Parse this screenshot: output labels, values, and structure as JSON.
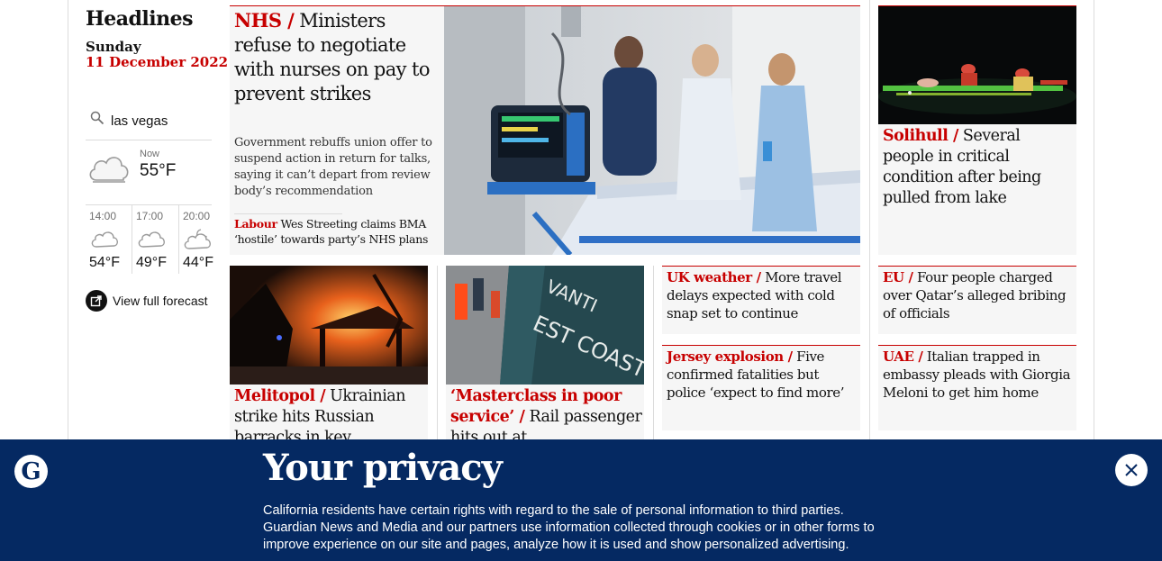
{
  "sidebar": {
    "title": "Headlines",
    "day": "Sunday",
    "date": "11 December 2022",
    "search_location": "las vegas",
    "weather_now": {
      "label": "Now",
      "temp": "55°F",
      "icon": "cloud-icon"
    },
    "forecast": [
      {
        "time": "14:00",
        "temp": "54°F",
        "icon": "cloud-icon"
      },
      {
        "time": "17:00",
        "temp": "49°F",
        "icon": "cloud-icon"
      },
      {
        "time": "20:00",
        "temp": "44°F",
        "icon": "partly-cloudy-night-icon"
      }
    ],
    "forecast_link": "View full forecast"
  },
  "main_story": {
    "kicker": "NHS /",
    "headline": " Ministers refuse to negotiate with nurses on pay to prevent strikes",
    "standfirst": "Government rebuffs union offer to suspend action in return for talks, saying it can’t depart from review body’s recommendation",
    "sublink_kicker": "Labour",
    "sublink_text": " Wes Streeting claims BMA ‘hostile’ towards party’s NHS plans"
  },
  "stories": {
    "solihull": {
      "kicker": "Solihull /",
      "headline": " Several people in critical condition after being pulled from lake"
    },
    "melitopol": {
      "kicker": "Melitopol /",
      "headline": " Ukrainian strike hits Russian barracks in key"
    },
    "avanti": {
      "kicker": "‘Masterclass in poor service’ /",
      "headline": " Rail passenger hits out at"
    },
    "uk_weather": {
      "kicker": "UK weather /",
      "headline": " More travel delays expected with cold snap set to continue"
    },
    "jersey": {
      "kicker": "Jersey explosion /",
      "headline": " Five confirmed fatalities but police ‘expect to find more’"
    },
    "eu": {
      "kicker": "EU /",
      "headline": " Four people charged over Qatar’s alleged bribing of officials"
    },
    "uae": {
      "kicker": "UAE /",
      "headline": " Italian trapped in embassy pleads with Giorgia Meloni to get him home"
    }
  },
  "avanti_train_text": {
    "line1": "VANTI",
    "line2": "EST COAST"
  },
  "privacy": {
    "title": "Your privacy",
    "body": "California residents have certain rights with regard to the sale of personal information to third parties. Guardian News and Media and our partners use information collected through cookies or in other forms to improve experience on our site and pages, analyze how it is used and show personalized advertising."
  },
  "colors": {
    "accent": "#c70000",
    "banner": "#052962",
    "card": "#f6f6f6"
  }
}
